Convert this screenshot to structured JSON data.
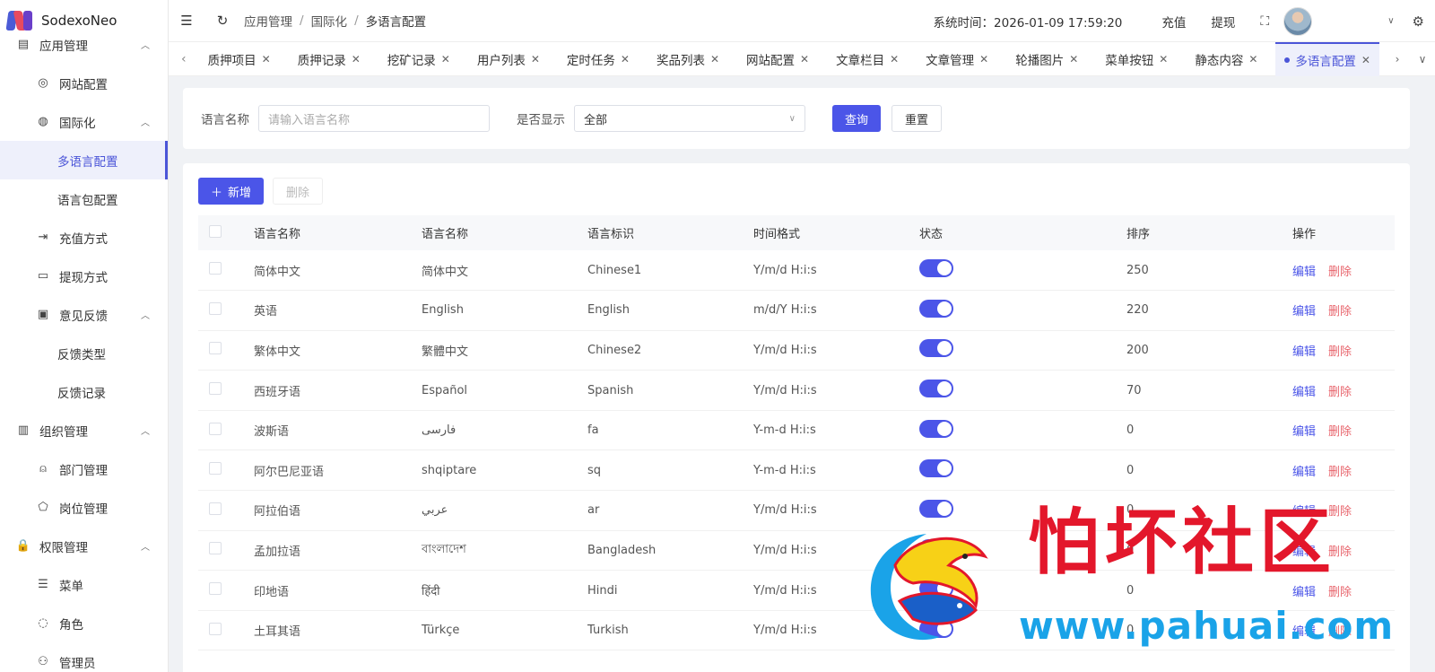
{
  "app": {
    "name": "SodexoNeo"
  },
  "sidebar": {
    "items": [
      {
        "label": "应用管理",
        "icon": "app-manage-icon",
        "level": 1
      },
      {
        "label": "网站配置",
        "icon": "globe-icon",
        "level": 2
      },
      {
        "label": "国际化",
        "icon": "translate-icon",
        "level": 2
      },
      {
        "label": "多语言配置",
        "icon": "",
        "level": 3,
        "active": true
      },
      {
        "label": "语言包配置",
        "icon": "",
        "level": 3
      },
      {
        "label": "充值方式",
        "icon": "recharge-icon",
        "level": 2
      },
      {
        "label": "提现方式",
        "icon": "folder-icon",
        "level": 2
      },
      {
        "label": "意见反馈",
        "icon": "message-icon",
        "level": 2
      },
      {
        "label": "反馈类型",
        "icon": "",
        "level": 3
      },
      {
        "label": "反馈记录",
        "icon": "",
        "level": 3
      },
      {
        "label": "组织管理",
        "icon": "building-icon",
        "level": 1
      },
      {
        "label": "部门管理",
        "icon": "person-icon",
        "level": 2
      },
      {
        "label": "岗位管理",
        "icon": "badge-icon",
        "level": 2
      },
      {
        "label": "权限管理",
        "icon": "lock-icon",
        "level": 1
      },
      {
        "label": "菜单",
        "icon": "sliders-icon",
        "level": 2
      },
      {
        "label": "角色",
        "icon": "bulb-icon",
        "level": 2
      },
      {
        "label": "管理员",
        "icon": "admin-icon",
        "level": 2
      }
    ]
  },
  "header": {
    "breadcrumb": [
      "应用管理",
      "国际化",
      "多语言配置"
    ],
    "system_time": "系统时间：2026-01-09 17:59:20",
    "recharge": "充值",
    "withdraw": "提现"
  },
  "tabs": [
    {
      "label": "质押项目"
    },
    {
      "label": "质押记录"
    },
    {
      "label": "挖矿记录"
    },
    {
      "label": "用户列表"
    },
    {
      "label": "定时任务"
    },
    {
      "label": "奖品列表"
    },
    {
      "label": "网站配置"
    },
    {
      "label": "文章栏目"
    },
    {
      "label": "文章管理"
    },
    {
      "label": "轮播图片"
    },
    {
      "label": "菜单按钮"
    },
    {
      "label": "静态内容"
    },
    {
      "label": "多语言配置",
      "active": true
    },
    {
      "label": "i"
    }
  ],
  "search": {
    "name_label": "语言名称",
    "name_placeholder": "请输入语言名称",
    "show_label": "是否显示",
    "show_value": "全部",
    "query": "查询",
    "reset": "重置"
  },
  "toolbar": {
    "add": "新增",
    "delete": "删除"
  },
  "table": {
    "headers": [
      "语言名称",
      "语言名称",
      "语言标识",
      "时间格式",
      "状态",
      "排序",
      "操作"
    ],
    "edit": "编辑",
    "del": "删除",
    "rows": [
      {
        "name": "简体中文",
        "native": "简体中文",
        "code": "Chinese1",
        "format": "Y/m/d H:i:s",
        "status": true,
        "sort": "250"
      },
      {
        "name": "英语",
        "native": "English",
        "code": "English",
        "format": "m/d/Y H:i:s",
        "status": true,
        "sort": "220"
      },
      {
        "name": "繁体中文",
        "native": "繁體中文",
        "code": "Chinese2",
        "format": "Y/m/d H:i:s",
        "status": true,
        "sort": "200"
      },
      {
        "name": "西班牙语",
        "native": "Español",
        "code": "Spanish",
        "format": "Y/m/d H:i:s",
        "status": true,
        "sort": "70"
      },
      {
        "name": "波斯语",
        "native": "فارسی",
        "code": "fa",
        "format": "Y-m-d H:i:s",
        "status": true,
        "sort": "0"
      },
      {
        "name": "阿尔巴尼亚语",
        "native": "shqiptare",
        "code": "sq",
        "format": "Y-m-d H:i:s",
        "status": true,
        "sort": "0"
      },
      {
        "name": "阿拉伯语",
        "native": "عربي",
        "code": "ar",
        "format": "Y/m/d H:i:s",
        "status": true,
        "sort": "0"
      },
      {
        "name": "孟加拉语",
        "native": "বাংলাদেশ",
        "code": "Bangladesh",
        "format": "Y/m/d H:i:s",
        "status": true,
        "sort": "0"
      },
      {
        "name": "印地语",
        "native": "हिंदी",
        "code": "Hindi",
        "format": "Y/m/d H:i:s",
        "status": true,
        "sort": "0"
      },
      {
        "name": "土耳其语",
        "native": "Türkçe",
        "code": "Turkish",
        "format": "Y/m/d H:i:s",
        "status": true,
        "sort": "0"
      }
    ]
  },
  "watermark": {
    "title": "怕坏社区",
    "url": "www.pahuai.com"
  },
  "colors": {
    "primary": "#4b55e8",
    "danger": "#e8646c",
    "watermark_red": "#e3172b",
    "watermark_blue": "#1aa3e8"
  }
}
